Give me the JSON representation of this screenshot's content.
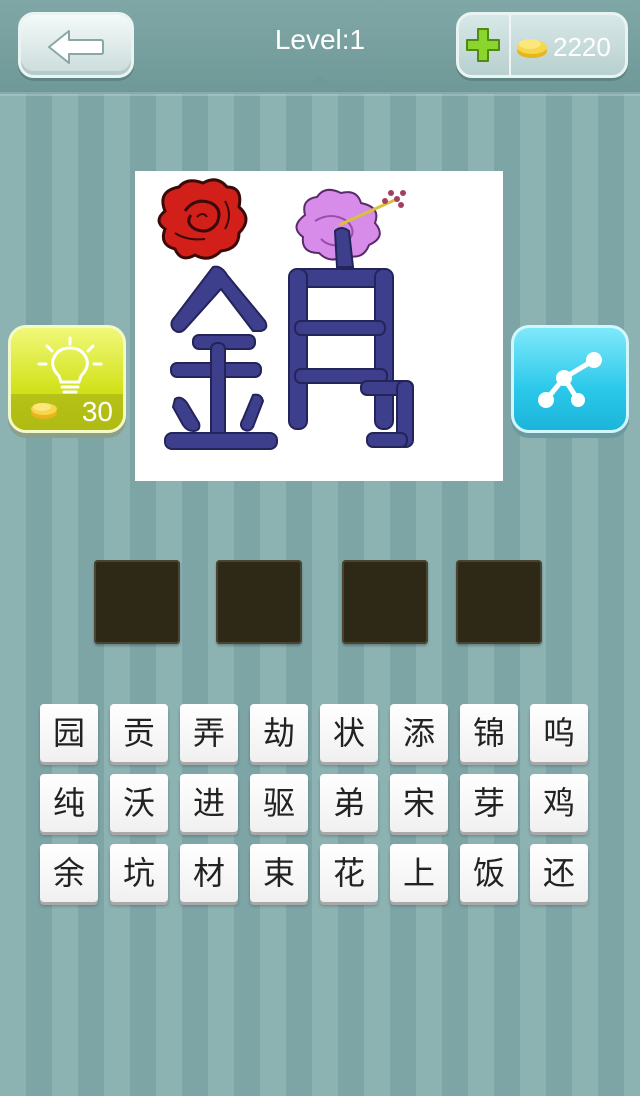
{
  "header": {
    "level_label": "Level:1",
    "coins": "2220"
  },
  "hint": {
    "cost": "30"
  },
  "puzzle": {
    "answer_length": 4
  },
  "letters": [
    "园",
    "贡",
    "弄",
    "劫",
    "状",
    "添",
    "锦",
    "呜",
    "纯",
    "沃",
    "进",
    "驱",
    "弟",
    "宋",
    "芽",
    "鸡",
    "余",
    "坑",
    "材",
    "束",
    "花",
    "上",
    "饭",
    "还"
  ],
  "colors": {
    "header": "#6f9998",
    "hint_button": "#d3e21c",
    "share_button": "#2bc8ea",
    "answer_slot": "#2e2916",
    "character_blue": "#3d3f8c"
  }
}
